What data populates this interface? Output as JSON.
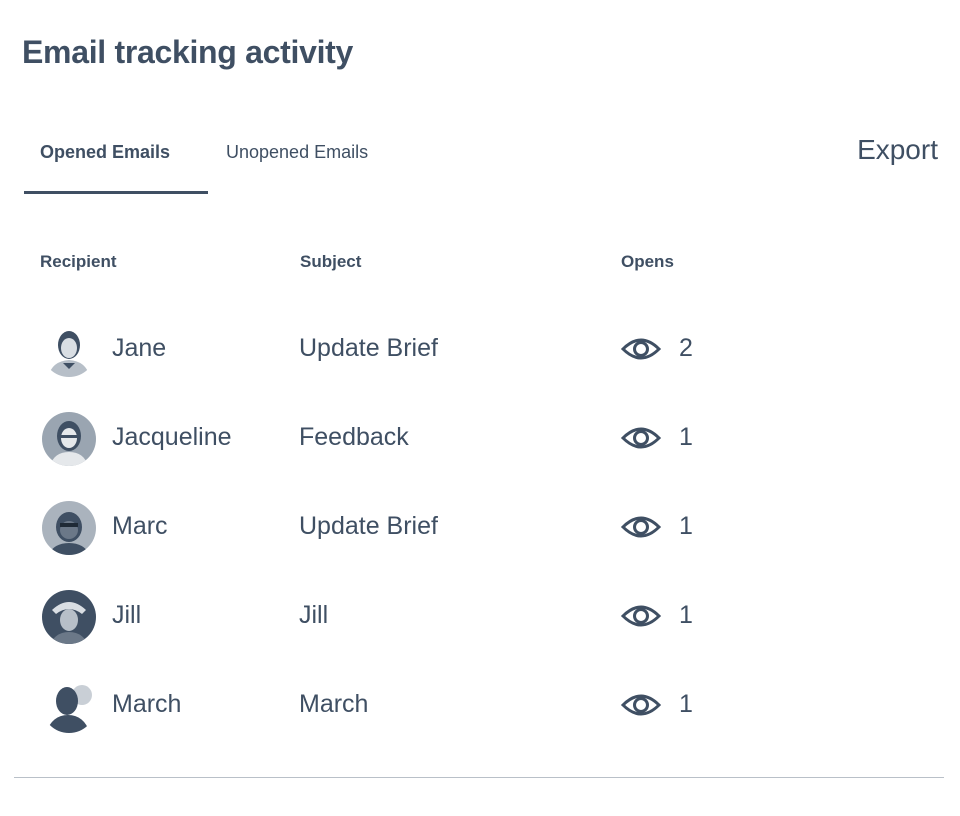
{
  "page": {
    "title": "Email tracking activity"
  },
  "tabs": [
    {
      "label": "Opened Emails",
      "active": true
    },
    {
      "label": "Unopened Emails",
      "active": false
    }
  ],
  "toolbar": {
    "export_label": "Export"
  },
  "table": {
    "headers": {
      "recipient": "Recipient",
      "subject": "Subject",
      "opens": "Opens"
    },
    "rows": [
      {
        "recipient": "Jane",
        "subject": "Update Brief",
        "opens": "2",
        "icon": "eye-icon"
      },
      {
        "recipient": "Jacqueline",
        "subject": "Feedback",
        "opens": "1",
        "icon": "eye-icon"
      },
      {
        "recipient": "Marc",
        "subject": "Update Brief",
        "opens": "1",
        "icon": "eye-icon"
      },
      {
        "recipient": "Jill",
        "subject": "Jill",
        "opens": "1",
        "icon": "eye-icon"
      },
      {
        "recipient": "March",
        "subject": "March",
        "opens": "1",
        "icon": "eye-icon"
      }
    ]
  },
  "colors": {
    "text": "#3f4f63",
    "divider": "#b9c0c8"
  }
}
